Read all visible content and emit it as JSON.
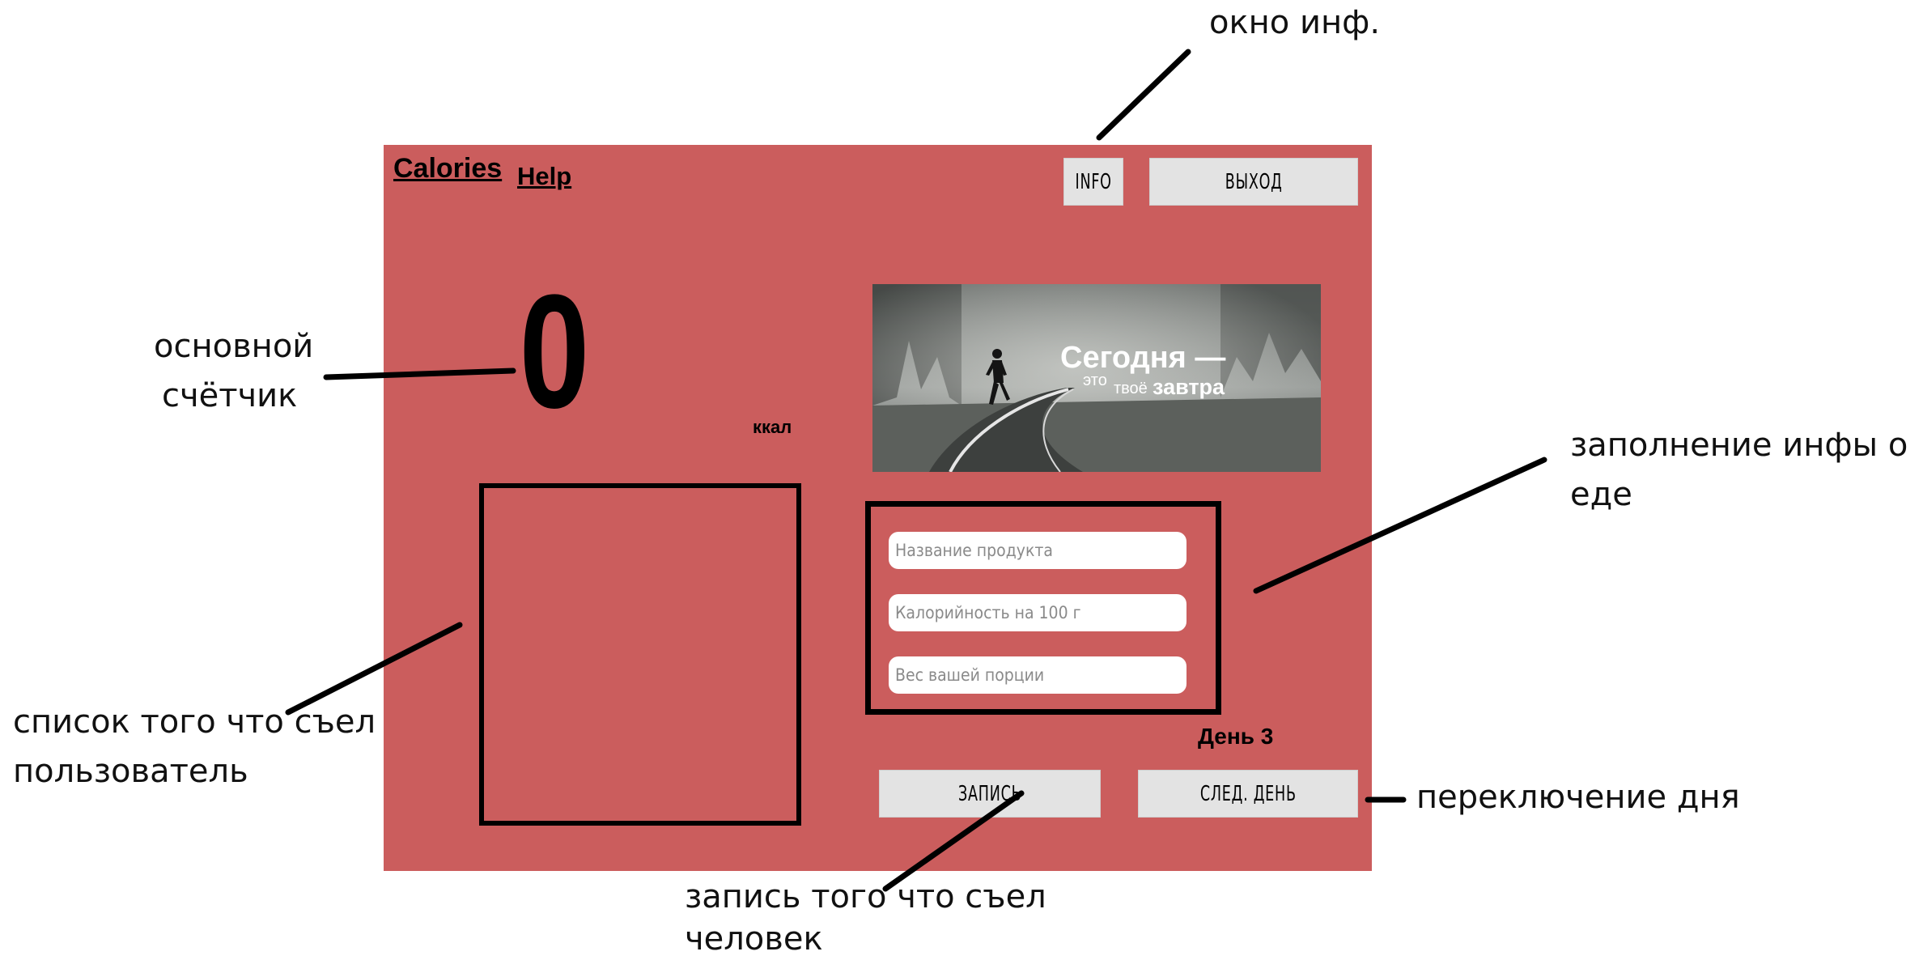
{
  "app": {
    "title": "Calories",
    "help_link": "Help",
    "info_button": "INFO",
    "exit_button": "ВЫХОД",
    "counter_value": "0",
    "counter_unit": "ккал",
    "banner": {
      "line1": "Сегодня —",
      "line2a": "это",
      "line2b": "твоё",
      "line2c": "завтра"
    },
    "form": {
      "product_name_placeholder": "Название продукта",
      "calories_placeholder": "Калорийность на 100 г",
      "portion_placeholder": "Вес вашей порции"
    },
    "day_label": "День 3",
    "record_button": "ЗАПИСЬ",
    "next_day_button": "СЛЕД. ДЕНЬ"
  },
  "annotations": {
    "info_window": "окно инф.",
    "main_counter_1": "основной",
    "main_counter_2": "счётчик",
    "food_info_1": "заполнение инфы о",
    "food_info_2": "еде",
    "eaten_list_1": "список того что съел",
    "eaten_list_2": "пользователь",
    "day_switch": "переключение дня",
    "record_1": "запись того что съел",
    "record_2": "человек"
  },
  "colors": {
    "app_background": "#cb5d5d",
    "button_background": "#e3e3e3",
    "annotation_line": "#000000"
  }
}
